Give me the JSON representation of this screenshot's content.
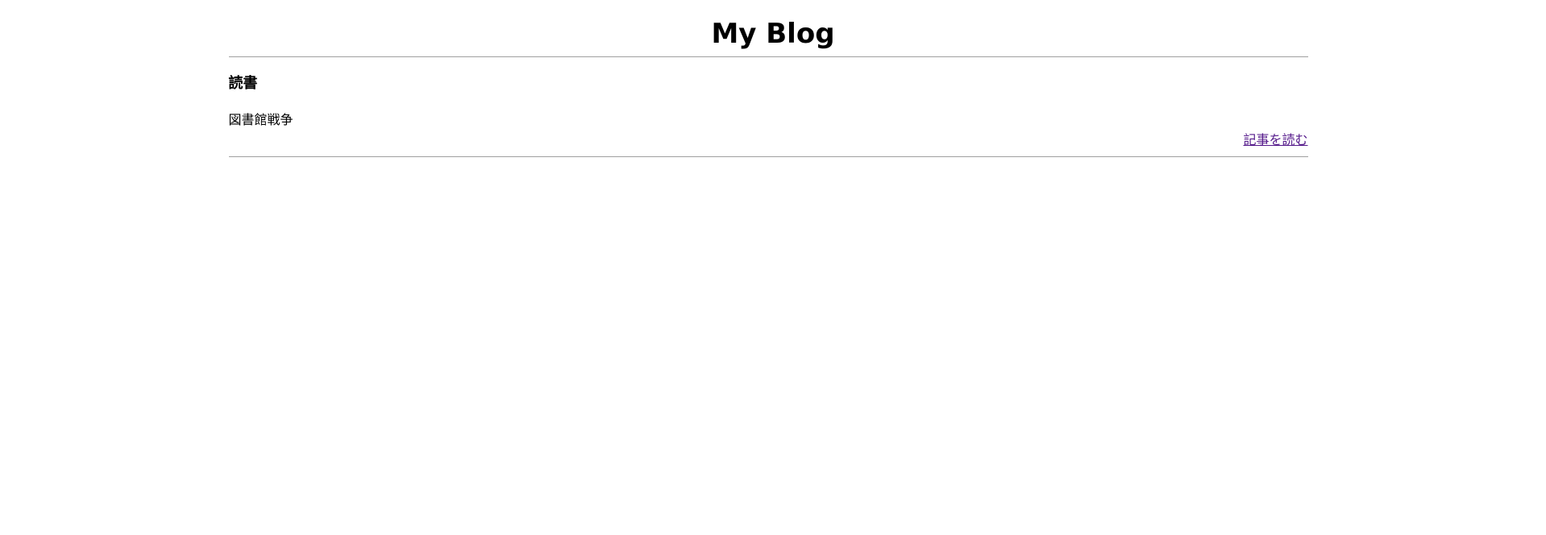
{
  "header": {
    "title": "My Blog"
  },
  "post": {
    "category": "読書",
    "title": "図書館戦争",
    "read_more_label": "記事を読む"
  },
  "colors": {
    "link_visited": "#551a8b",
    "divider": "#a0a0a0"
  }
}
